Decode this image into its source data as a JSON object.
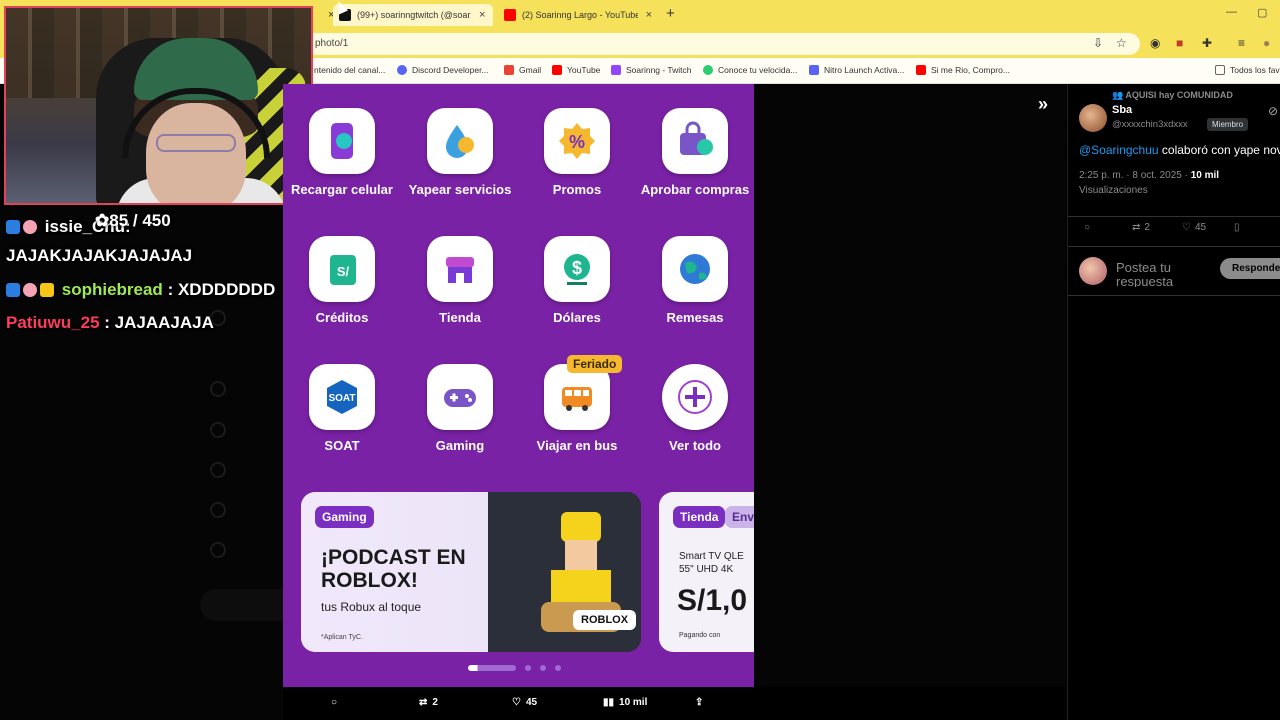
{
  "browser": {
    "tabs": [
      {
        "title": "(99+) soarinngtwitch (@soarinn",
        "favicon_color": "#111111"
      },
      {
        "title": "(2) Soarinng Largo - YouTube",
        "favicon_color": "#ff0000"
      }
    ],
    "url": "photo/1",
    "bookmarks": [
      {
        "label": "ntenido del canal...",
        "color": "#ff0000"
      },
      {
        "label": "Discord Developer...",
        "color": "#5865f2"
      },
      {
        "label": "Gmail",
        "color": "#ea4335"
      },
      {
        "label": "YouTube",
        "color": "#ff0000"
      },
      {
        "label": "Soarinng - Twitch",
        "color": "#9146ff"
      },
      {
        "label": "Conoce tu velocida...",
        "color": "#2ecc71"
      },
      {
        "label": "Nitro Launch Activa...",
        "color": "#5865f2"
      },
      {
        "label": "Si me Rio, Compro...",
        "color": "#ff0000"
      },
      {
        "label": "Todos los fav",
        "color": "#888888"
      }
    ]
  },
  "stream": {
    "counter": "85 / 450",
    "chat": [
      {
        "user": "issie_Chu",
        "user_color": "#ffffff",
        "message": ":"
      },
      {
        "user": "",
        "user_color": "#ffffff",
        "message": "JAJAKJAJAKJAJAJAJ"
      },
      {
        "user": "sophiebread",
        "user_color": "#9dea55",
        "message": ": XDDDDDDD"
      },
      {
        "user": "Patiuwu_25",
        "user_color": "#ff3b5c",
        "message": ": JAJAAJAJA"
      }
    ]
  },
  "yape": {
    "items": [
      {
        "label": "Recargar celular",
        "icon": "phone-topup-icon"
      },
      {
        "label": "Yapear servicios",
        "icon": "drop-bulb-icon"
      },
      {
        "label": "Promos",
        "icon": "percent-badge-icon"
      },
      {
        "label": "Aprobar compras",
        "icon": "bag-check-icon"
      },
      {
        "label": "Créditos",
        "icon": "credit-card-icon"
      },
      {
        "label": "Tienda",
        "icon": "store-icon"
      },
      {
        "label": "Dólares",
        "icon": "dollar-icon"
      },
      {
        "label": "Remesas",
        "icon": "globe-icon"
      },
      {
        "label": "SOAT",
        "icon": "soat-icon"
      },
      {
        "label": "Gaming",
        "icon": "gamepad-icon"
      },
      {
        "label": "Viajar en bus",
        "icon": "bus-icon"
      },
      {
        "label": "Ver todo",
        "icon": "plus-icon"
      }
    ],
    "feriado_badge": "Feriado",
    "banner1": {
      "pill": "Gaming",
      "title": "¡PODCAST EN ROBLOX!",
      "subtitle": "tus Robux al toque",
      "note": "*Aplican TyC.",
      "logo": "ROBLOX"
    },
    "banner2": {
      "pill": "Tienda",
      "pill2": "Env",
      "title_line1": "Smart TV QLE",
      "title_line2": "55\" UHD 4K",
      "price": "S/1,0",
      "pay": "Pagando con"
    },
    "colors": {
      "background": "#7a22a6",
      "tile": "#ffffff"
    }
  },
  "tweet": {
    "community": "AQUISI hay COMUNIDAD",
    "name": "Sba",
    "handle": "@xxxxchin3xdxxx",
    "member_badge": "Miembro",
    "mention": "@Soaringchuu",
    "text": " colaboró con yape nov",
    "time": "2:25 p. m. · 8 oct. 2025 · ",
    "views_count": "10 mil",
    "views_label": "Visualizaciones",
    "actions": {
      "reposts": "2",
      "likes": "45"
    },
    "reply_placeholder": "Postea tu respuesta",
    "reply_button": "Responder"
  },
  "bottom_bar": {
    "reposts": "2",
    "likes": "45",
    "views": "10 mil"
  }
}
